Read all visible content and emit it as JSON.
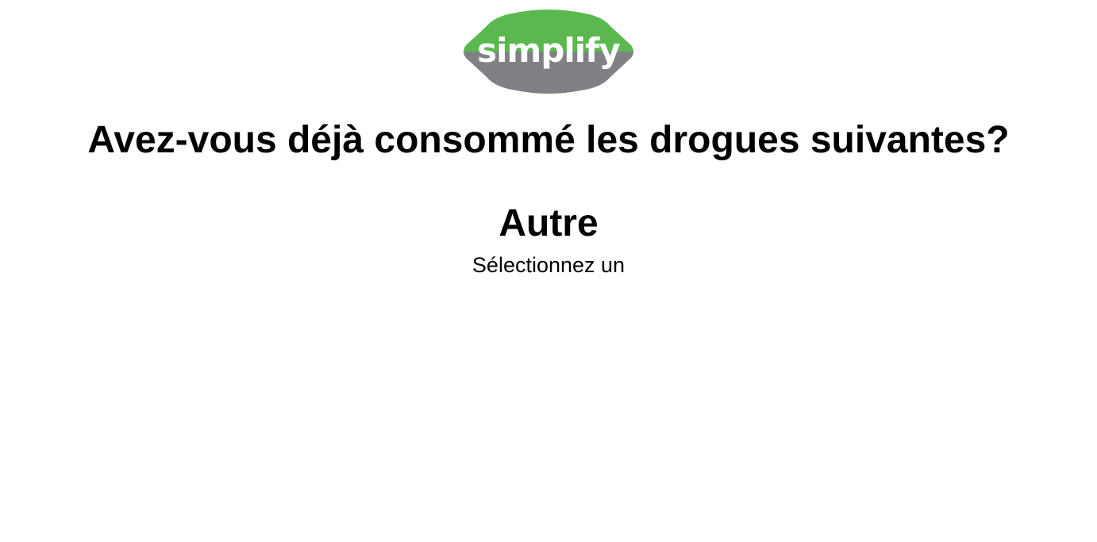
{
  "logo": {
    "text": "simplify",
    "icon": "simplify-logo",
    "colors": {
      "top": "#5ab84e",
      "bottom": "#808184",
      "text": "#ffffff"
    }
  },
  "question": {
    "title": "Avez-vous déjà consommé les drogues suivantes?"
  },
  "item": {
    "name": "Autre",
    "prompt": "Sélectionnez un"
  }
}
